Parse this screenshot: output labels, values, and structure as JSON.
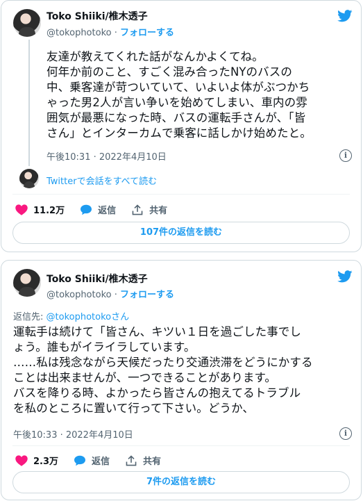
{
  "colors": {
    "accent": "#1d9bf0",
    "like": "#f91880",
    "muted": "#536471",
    "text": "#0f1419",
    "border": "#cfd9de"
  },
  "tweets": [
    {
      "name": "Toko Shiiki/椎木透子",
      "handle": "@tokophotoko",
      "separator": "·",
      "follow_label": "フォローする",
      "text": "友達が教えてくれた話がなんかよくてね。\n何年か前のこと、すごく混み合ったNYのバスの\n中、乗客達が苛ついていて、いよいよ体がぶつかち\nゃった男2人が言い争いを始めてしまい、車内の雰\n囲気が最悪になった時、バスの運転手さんが、「皆\nさん」とインターカムで乗客に話しかけ始めたと。",
      "timestamp": "午後10:31 · 2022年4月10日",
      "info_icon": "i",
      "conversation_link": "Twitterで会話をすべて読む",
      "likes": "11.2万",
      "reply_label": "返信",
      "share_label": "共有",
      "read_replies_label": "107件の返信を読む"
    },
    {
      "name": "Toko Shiiki/椎木透子",
      "handle": "@tokophotoko",
      "separator": "·",
      "follow_label": "フォローする",
      "reply_to_prefix": "返信先: ",
      "reply_to_handle": "@tokophotokoさん",
      "text": "運転手は続けて「皆さん、キツい１日を過ごした事でし\nょう。誰もがイライラしています。\n……私は残念ながら天候だったり交通渋滞をどうにかする\nことは出来ませんが、一つできることがあります。\nバスを降りる時、よかったら皆さんの抱えてるトラブル\nを私のところに置いて行って下さい。どうか、",
      "timestamp": "午後10:33 · 2022年4月10日",
      "info_icon": "i",
      "likes": "2.3万",
      "reply_label": "返信",
      "share_label": "共有",
      "read_replies_label": "7件の返信を読む"
    }
  ]
}
